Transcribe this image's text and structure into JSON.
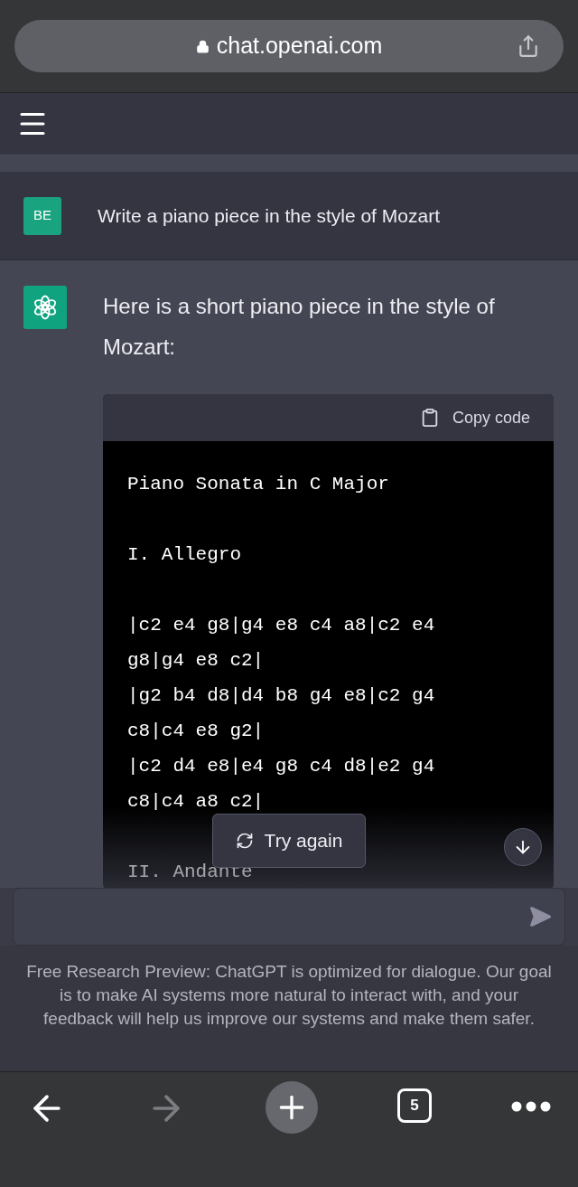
{
  "browser": {
    "url": "chat.openai.com",
    "tab_count": "5"
  },
  "messages": [
    {
      "kind": "user",
      "avatar": "BE",
      "text": "Write a piano piece in the style of Mozart"
    },
    {
      "kind": "assistant",
      "text": "Here is a short piano piece in the style of Mozart:",
      "code": {
        "copy_label": "Copy code",
        "blocks": [
          [
            "Piano Sonata in C Major"
          ],
          [
            "I. Allegro"
          ],
          [
            "|c2 e4 g8|g4 e8 c4 a8|c2 e4",
            "g8|g4 e8 c2|",
            "|g2 b4 d8|d4 b8 g4 e8|c2 g4",
            "c8|c4 e8 g2|",
            "|c2 d4 e8|e4 g8 c4 d8|e2 g4",
            "c8|c4 a8 c2|"
          ],
          [
            "II. Andante"
          ]
        ]
      }
    }
  ],
  "try_again": "Try again",
  "composer": {
    "disabled": true
  },
  "footer": "Free Research Preview: ChatGPT is optimized for dialogue. Our goal is to make AI systems more natural to interact with, and your feedback will help us improve our systems and make them safer.",
  "toolbar": {
    "forward_disabled": true
  }
}
